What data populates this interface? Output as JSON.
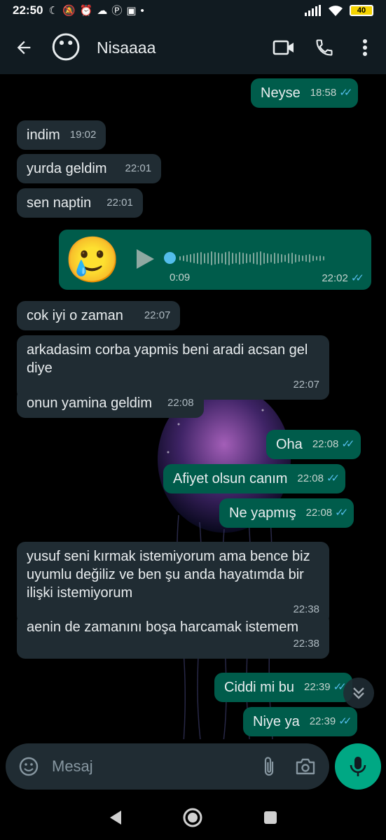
{
  "status_bar": {
    "time": "22:50",
    "battery": "40"
  },
  "header": {
    "contact_name": "Nisaaaa",
    "avatar_emoji": "😶"
  },
  "messages": [
    {
      "dir": "out",
      "text": "Neyse",
      "time": "18:58",
      "read": true
    },
    {
      "dir": "in",
      "text": "indim",
      "time": "19:02"
    },
    {
      "dir": "in",
      "text": "yurda geldim",
      "time": "22:01"
    },
    {
      "dir": "in",
      "text": "sen naptin",
      "time": "22:01"
    },
    {
      "dir": "in",
      "text": "cok iyi o zaman",
      "time": "22:07"
    },
    {
      "dir": "in",
      "text": "arkadasim corba yapmis beni aradi acsan gel diye",
      "time": "22:07"
    },
    {
      "dir": "in",
      "text": "onun yamina geldim",
      "time": "22:08"
    },
    {
      "dir": "out",
      "text": "Oha",
      "time": "22:08",
      "read": true
    },
    {
      "dir": "out",
      "text": "Afiyet olsun canım",
      "time": "22:08",
      "read": true
    },
    {
      "dir": "out",
      "text": "Ne yapmış",
      "time": "22:08",
      "read": true
    },
    {
      "dir": "in",
      "text": "yusuf seni kırmak istemiyorum ama bence biz uyumlu değiliz ve ben şu anda hayatımda bir ilişki istemiyorum",
      "time": "22:38"
    },
    {
      "dir": "in",
      "text": "aenin de zamanını boşa harcamak istemem",
      "time": "22:38"
    },
    {
      "dir": "out",
      "text": "Ciddi mi bu",
      "time": "22:39",
      "read": true
    },
    {
      "dir": "out",
      "text": "Niye ya",
      "time": "22:39",
      "read": true
    }
  ],
  "voice_message": {
    "emoji": "🥲",
    "duration": "0:09",
    "time": "22:02",
    "read": true
  },
  "input": {
    "placeholder": "Mesaj"
  },
  "colors": {
    "incoming": "#202c33",
    "outgoing": "#005c4b",
    "accent": "#00a884",
    "read_tick": "#53bdeb"
  }
}
